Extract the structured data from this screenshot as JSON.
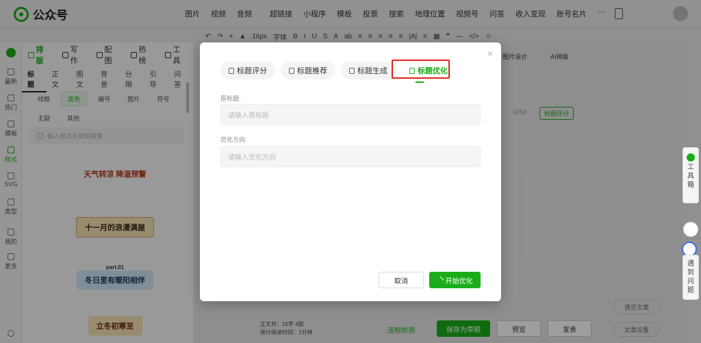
{
  "app": {
    "title": "公众号"
  },
  "topnav": [
    "图片",
    "视频",
    "音频",
    "超链接",
    "小程序",
    "模板",
    "投票",
    "搜索",
    "地理位置",
    "视频号",
    "问答",
    "收入变现",
    "账号名片",
    "···"
  ],
  "toolbar": {
    "items": [
      "↶",
      "↷",
      "⌖",
      "▲",
      "16px",
      "字体",
      "B",
      "I",
      "U",
      "S",
      "A",
      "ab",
      "≡",
      "≡",
      "≡",
      "≡",
      "≡",
      "|A|",
      "≡",
      "▦",
      "❞",
      "—",
      "</>",
      "☺"
    ]
  },
  "leftrail": [
    "最新",
    "热门",
    "模板",
    "样式",
    "SVG",
    "类型",
    "我的",
    "更多"
  ],
  "panel": {
    "tabs": [
      "排版",
      "写作",
      "配图",
      "热榜",
      "工具"
    ],
    "subtabs": [
      "标题",
      "正文",
      "图文",
      "背景",
      "分隔",
      "引导",
      "问答"
    ],
    "chips": [
      "线框",
      "底色",
      "编号",
      "图片",
      "符号",
      "主副",
      "其他"
    ],
    "search_placeholder": "输入样式关键词搜索",
    "templates": [
      "天气转凉 降温预警",
      "十一月的浪漫满屋",
      "part.01",
      "冬日里有暖阳相伴",
      "立冬初寒至"
    ]
  },
  "editor": {
    "counter": "0/64",
    "title_score": "标题评分",
    "ai_buttons": [
      "图片设计",
      "AI排版"
    ]
  },
  "right": {
    "toolbox": [
      "工",
      "具",
      "箱"
    ],
    "help": [
      "遇",
      "到",
      "问",
      "题"
    ],
    "clear": "清空文章",
    "settings": "文章设置"
  },
  "bottom": {
    "stats1": "正文共：",
    "count": "15字 4图",
    "stats2": "预计阅读时间：",
    "time": "1分钟",
    "check": "违规检测",
    "save": "保存为草稿",
    "preview": "预览",
    "publish": "发表"
  },
  "modal": {
    "close": "×",
    "tabs": [
      "标题评分",
      "标题推荐",
      "标题生成",
      "标题优化"
    ],
    "original_label": "原标题:",
    "original_placeholder": "请输入原标题",
    "direction_label": "优化方向:",
    "direction_placeholder": "请输入优化方向",
    "cancel": "取消",
    "start": "开始优化"
  },
  "colors": {
    "accent": "#1aad19",
    "highlight": "#e0231c"
  }
}
